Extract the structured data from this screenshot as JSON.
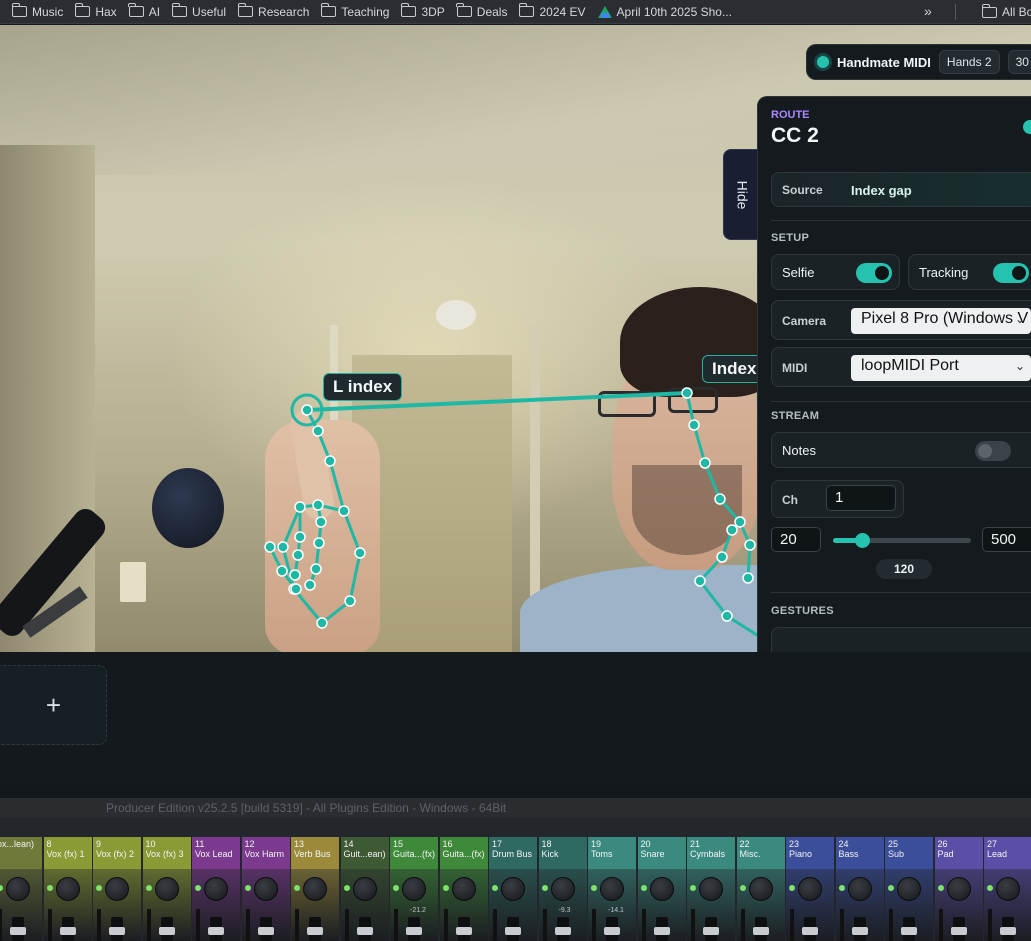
{
  "bookmarks": {
    "items": [
      {
        "label": "Music",
        "icon": "folder-icon"
      },
      {
        "label": "Hax",
        "icon": "folder-icon"
      },
      {
        "label": "AI",
        "icon": "folder-icon"
      },
      {
        "label": "Useful",
        "icon": "folder-icon"
      },
      {
        "label": "Research",
        "icon": "folder-icon"
      },
      {
        "label": "Teaching",
        "icon": "folder-icon"
      },
      {
        "label": "3DP",
        "icon": "folder-icon"
      },
      {
        "label": "Deals",
        "icon": "folder-icon"
      },
      {
        "label": "2024 EV",
        "icon": "folder-icon"
      },
      {
        "label": "April 10th 2025 Sho...",
        "icon": "google-drive-icon"
      }
    ],
    "more": "»",
    "all": "All Boo"
  },
  "camera": {
    "tag_left": "L index",
    "tag_right": "Index"
  },
  "toolbar": {
    "title": "Handmate MIDI",
    "hands_chip": "Hands 2",
    "fps_chip": "30 f"
  },
  "hide_tab": "Hide",
  "panel": {
    "route_label": "ROUTE",
    "route_name": "CC 2",
    "source_label": "Source",
    "source_value": "Index gap",
    "setup_label": "SETUP",
    "selfie_label": "Selfie",
    "tracking_label": "Tracking",
    "camera_label": "Camera",
    "camera_value": "Pixel 8 Pro (Windows V",
    "midi_label": "MIDI",
    "midi_value": "loopMIDI Port",
    "stream_label": "STREAM",
    "notes_label": "Notes",
    "ch_label": "Ch",
    "ch_value": "1",
    "min_value": "20",
    "max_value": "500",
    "current_value": "120",
    "current_fraction": 0.21,
    "gestures_label": "GESTURES"
  },
  "add_slot": "+",
  "fl": {
    "title": "Producer Edition v25.2.5 [build 5319] - All Plugins Edition - Windows - 64Bit",
    "strips": [
      {
        "num": "",
        "name": "ox...lean)",
        "color": "#6f7a3a",
        "db": ""
      },
      {
        "num": "8",
        "name": "Vox (fx) 1",
        "color": "#8a9a34",
        "db": ""
      },
      {
        "num": "9",
        "name": "Vox (fx) 2",
        "color": "#8a9a34",
        "db": ""
      },
      {
        "num": "10",
        "name": "Vox (fx) 3",
        "color": "#8a9a34",
        "db": ""
      },
      {
        "num": "11",
        "name": "Vox Lead",
        "color": "#7b3a8e",
        "db": ""
      },
      {
        "num": "12",
        "name": "Vox Harm",
        "color": "#7b3a8e",
        "db": ""
      },
      {
        "num": "13",
        "name": "Verb Bus",
        "color": "#9a8a3a",
        "db": ""
      },
      {
        "num": "14",
        "name": "Guit...ean)",
        "color": "#3e5a34",
        "db": ""
      },
      {
        "num": "15",
        "name": "Guita...(fx) 1",
        "color": "#3f8a3a",
        "db": "-21.2"
      },
      {
        "num": "16",
        "name": "Guita...(fx) 2",
        "color": "#3f8a3a",
        "db": ""
      },
      {
        "num": "17",
        "name": "Drum Bus",
        "color": "#2e6a62",
        "db": ""
      },
      {
        "num": "18",
        "name": "Kick",
        "color": "#2e6a62",
        "db": "-9.3"
      },
      {
        "num": "19",
        "name": "Toms",
        "color": "#3a8a80",
        "db": "-14.1"
      },
      {
        "num": "20",
        "name": "Snare",
        "color": "#3a8a80",
        "db": ""
      },
      {
        "num": "21",
        "name": "Cymbals",
        "color": "#3a8a80",
        "db": ""
      },
      {
        "num": "22",
        "name": "Misc.",
        "color": "#3a8a80",
        "db": ""
      },
      {
        "num": "23",
        "name": "Piano",
        "color": "#3a4e9a",
        "db": ""
      },
      {
        "num": "24",
        "name": "Bass",
        "color": "#3a4e9a",
        "db": ""
      },
      {
        "num": "25",
        "name": "Sub",
        "color": "#3a4e9a",
        "db": ""
      },
      {
        "num": "26",
        "name": "Pad",
        "color": "#5a4ea6",
        "db": ""
      },
      {
        "num": "27",
        "name": "Lead",
        "color": "#5a4ea6",
        "db": ""
      }
    ]
  },
  "colors": {
    "accent": "#25c2b0",
    "route_label": "#a98bff",
    "panel_bg": "#141a1e"
  }
}
